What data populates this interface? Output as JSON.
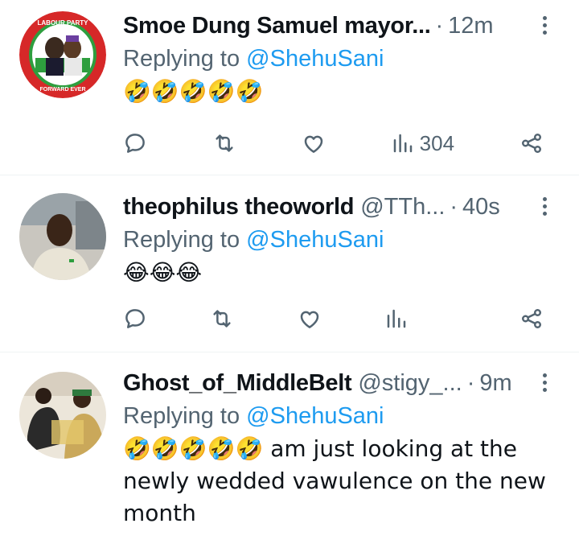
{
  "replies": [
    {
      "name": "Smoe Dung Samuel mayor...",
      "handle": "",
      "time": "12m",
      "replying_prefix": "Replying to ",
      "replying_to": "@ShehuSani",
      "text": "🤣🤣🤣🤣🤣",
      "views": "304"
    },
    {
      "name": "theophilus theoworld",
      "handle": "@TTh...",
      "time": "40s",
      "replying_prefix": "Replying to ",
      "replying_to": "@ShehuSani",
      "text": "😂😂😂",
      "views": ""
    },
    {
      "name": "Ghost_of_MiddleBelt",
      "handle": "@stigy_...",
      "time": "9m",
      "replying_prefix": "Replying to ",
      "replying_to": "@ShehuSani",
      "text": "🤣🤣🤣🤣🤣 am just looking at the newly wedded vawulence on the new month",
      "views": ""
    }
  ],
  "avatar_texts": {
    "labour_top": "LABOUR PARTY",
    "labour_bottom": "FORWARD EVER"
  },
  "colors": {
    "link": "#1d9bf0",
    "secondary": "#536471",
    "labour_red": "#d62828",
    "labour_green": "#2e9e3e"
  }
}
